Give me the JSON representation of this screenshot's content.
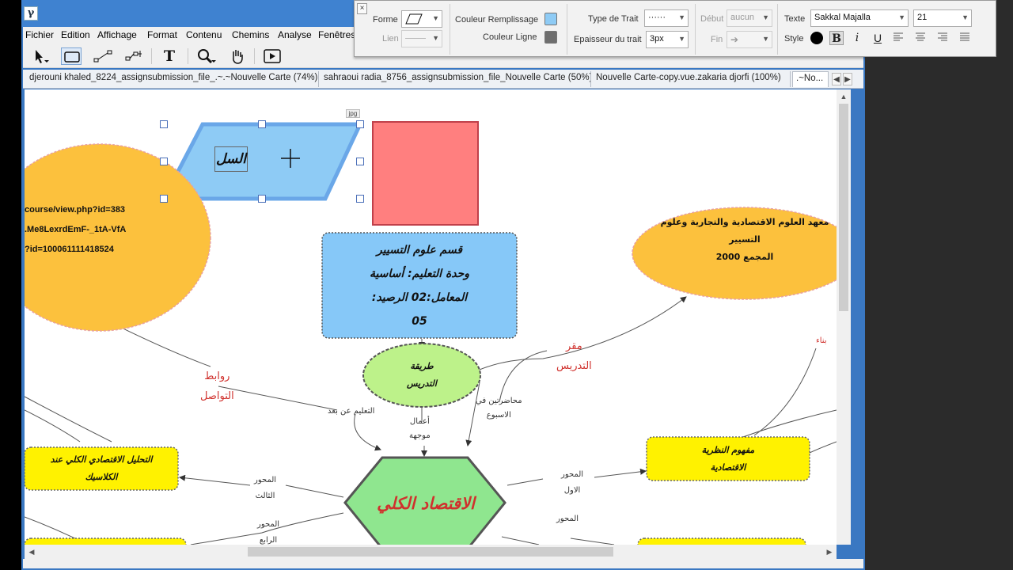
{
  "app": {
    "logo": "γ"
  },
  "menu": [
    "Fichier",
    "Edition",
    "Affichage",
    "Format",
    "Contenu",
    "Chemins",
    "Analyse",
    "Fenêtres"
  ],
  "toolbar": {
    "icons": [
      "select-arrow-icon",
      "rectangle-tool-icon",
      "link-tool-icon",
      "branch-tool-icon",
      "text-tool-icon",
      "zoom-icon",
      "hand-icon",
      "present-icon"
    ],
    "text_tool_glyph": "T"
  },
  "tabs": [
    {
      "label": "djerouni khaled_8224_assignsubmission_file_.~.~Nouvelle Carte (74%)"
    },
    {
      "label": "sahraoui radia_8756_assignsubmission_file_Nouvelle Carte (50%)"
    },
    {
      "label": "Nouvelle Carte-copy.vue.zakaria djorfi (100%)"
    },
    {
      "label": ".~No..."
    }
  ],
  "palette": {
    "forme_label": "Forme",
    "lien_label": "Lien",
    "couleur_remplissage_label": "Couleur Remplissage",
    "couleur_remplissage": "#8ecbf5",
    "couleur_ligne_label": "Couleur Ligne",
    "couleur_ligne": "#6e6e6e",
    "type_trait_label": "Type de Trait",
    "type_trait_value": "······",
    "epaisseur_label": "Epaisseur du trait",
    "epaisseur_value": "3px",
    "debut_label": "Début",
    "debut_value": "aucun",
    "fin_label": "Fin",
    "texte_label": "Texte",
    "font_value": "Sakkal Majalla",
    "font_size": "21",
    "style_label": "Style",
    "style_color": "#000000",
    "bold": "B",
    "italic": "i",
    "underline": "U"
  },
  "canvas": {
    "jpg_badge": "jpg",
    "selected_shape_text": "السل",
    "left_ellipse_lines": [
      "course/view.php?id=383",
      ".Me8LexrdEmF-_1tA-VfA",
      "?id=100061111418524"
    ],
    "center_box_lines": [
      "قسم علوم التسيير",
      "وحدة التعليم: أساسية",
      "المعامل:02 الرصيد:",
      "05"
    ],
    "right_ellipse_lines": [
      "معهد العلوم الاقتصادية والتجارية وعلوم",
      "التسيير",
      "المجمع 2000"
    ],
    "method_ellipse_lines": [
      "طريقة",
      "التدريس"
    ],
    "hexagon_text": "الاقتصاد الكلي",
    "yellow_left_lines": [
      "التحليل الاقتصادي الكلي عند",
      "الكلاسيك"
    ],
    "yellow_right_lines": [
      "مفهوم النظرية",
      "الاقتصادية"
    ],
    "labels": {
      "links": [
        "روابط",
        "التواصل"
      ],
      "venue": [
        "مقر",
        "التدريس"
      ],
      "distance": "التعليم عن بعد",
      "works": [
        "أعمال",
        "موجهة"
      ],
      "lectures": [
        "محاضرتين في",
        "الاسبوع"
      ],
      "axis1": [
        "المحور",
        "الاول"
      ],
      "axis3": [
        "المحور",
        "الثالث"
      ],
      "axis4": [
        "المحور",
        "الرابع"
      ],
      "axis2": "المحور",
      "build": "بناء"
    }
  },
  "colors": {
    "titlebar": "#3f82d0",
    "orange": "#fcc13d",
    "blue_box": "#86c8f8",
    "green": "#bdf28a",
    "hex_green": "#8fe68f",
    "yellow": "#fff200",
    "red_box": "#ff7f7f",
    "red_text": "#d0312d"
  }
}
